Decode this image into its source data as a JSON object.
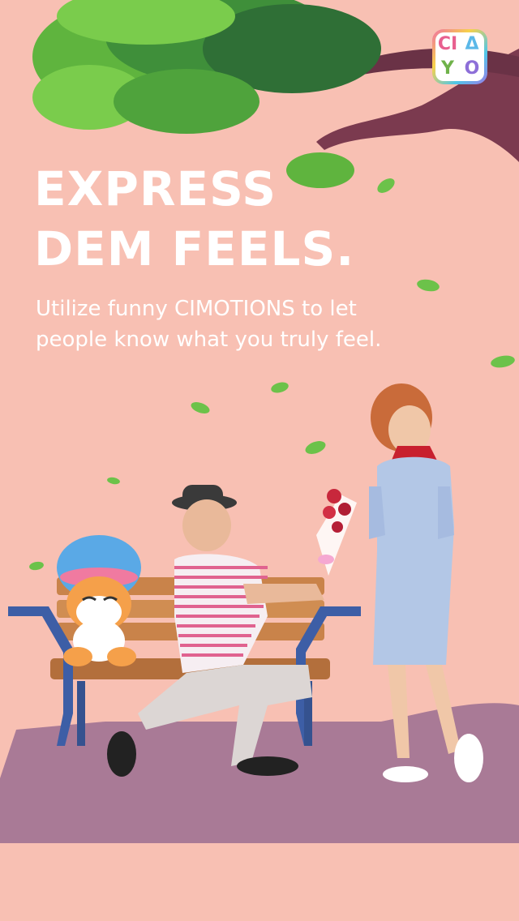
{
  "brand": {
    "logo_letters": [
      "CI",
      "Δ",
      "Y",
      "O"
    ]
  },
  "headline": {
    "line1": "EXPRESS",
    "line2": "DEM FEELS."
  },
  "subtitle": {
    "line1": "Utilize funny CIMOTIONS to let",
    "line2": "people know what you truly feel."
  },
  "colors": {
    "background": "#f8c0b3",
    "ground": "#a97a96",
    "text": "#ffffff",
    "tree_trunk": "#7b3a4f",
    "leaves": "#6cc24a"
  },
  "icons": [
    "ciayo-logo-icon"
  ]
}
